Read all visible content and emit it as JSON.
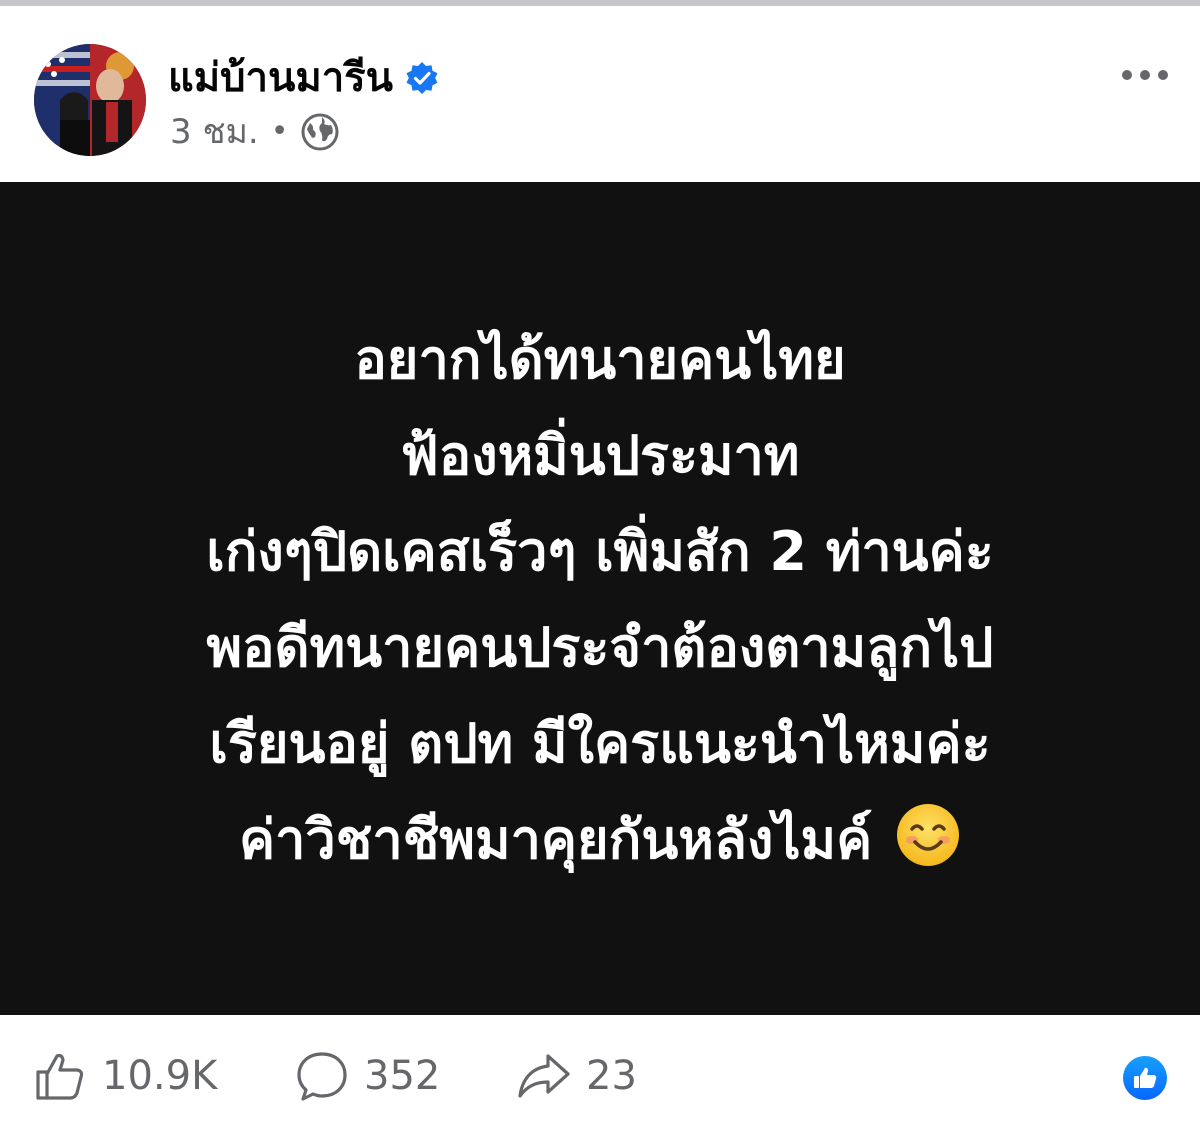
{
  "post": {
    "author": {
      "name": "แม่บ้านมารีน",
      "verified": true,
      "avatar": "avatar-couple-photo"
    },
    "meta": {
      "time": "3 ชม.",
      "separator": "•",
      "privacy_icon": "globe-icon"
    },
    "more_icon": "more-options-icon",
    "background_color": "#111111",
    "text_color": "#ffffff",
    "lines": [
      "อยากได้ทนายคนไทย",
      "ฟ้องหมิ่นประมาท",
      "เก่งๆปิดเคสเร็วๆ เพิ่มสัก 2 ท่านค่ะ",
      "พอดีทนายคนประจำต้องตามลูกไป",
      "เรียนอยู่ ตปท มีใครแนะนำไหมค่ะ",
      "ค่าวิชาชีพมาคุยกันหลังไมค์"
    ],
    "emoji": "smiling-face-icon"
  },
  "footer": {
    "likes": "10.9K",
    "comments": "352",
    "shares": "23",
    "like_icon": "thumbs-up-icon",
    "comment_icon": "speech-bubble-icon",
    "share_icon": "share-arrow-icon",
    "reaction_icon": "like-reaction-icon"
  },
  "colors": {
    "facebook_blue": "#1877f2",
    "secondary_text": "#65676b",
    "primary_text": "#050505"
  }
}
